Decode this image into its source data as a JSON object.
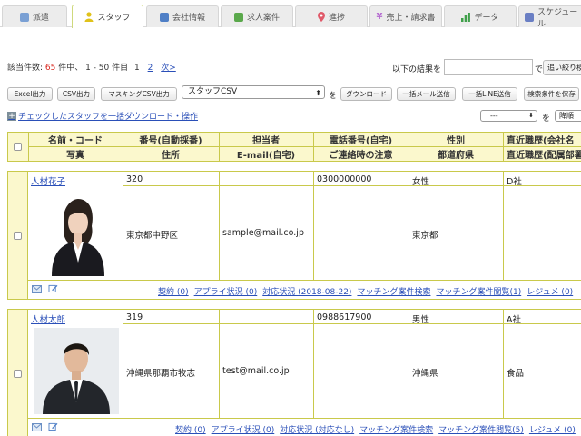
{
  "tabs": [
    {
      "label": "派遣",
      "icon": "building-icon",
      "color": "#7aa0d4",
      "active": false
    },
    {
      "label": "スタッフ",
      "icon": "person-icon",
      "color": "#e0c21a",
      "active": true
    },
    {
      "label": "会社情報",
      "icon": "office-icon",
      "color": "#4f7fc6",
      "active": false
    },
    {
      "label": "求人案件",
      "icon": "list-icon",
      "color": "#5aa84b",
      "active": false
    },
    {
      "label": "進捗",
      "icon": "pin-icon",
      "color": "#e05a6a",
      "active": false
    },
    {
      "label": "売上・請求書",
      "icon": "yen-icon",
      "color": "#b56ad0",
      "active": false
    },
    {
      "label": "データ",
      "icon": "chart-icon",
      "color": "#3fa04a",
      "active": false
    },
    {
      "label": "スケジュール",
      "icon": "calendar-icon",
      "color": "#6a7fc4",
      "active": false
    }
  ],
  "results": {
    "prefix": "該当件数:",
    "count": "65",
    "middle": "件中、 1 - 50 件目",
    "current_page": "1",
    "page2": "2",
    "next": "次>"
  },
  "filter": {
    "label": "以下の結果を",
    "value": "",
    "de": "で",
    "button": "追い絞り検索"
  },
  "toolbar": {
    "excel": "Excel出力",
    "csv": "CSV出力",
    "masking_csv": "マスキングCSV出力",
    "csv_select": "スタッフCSV",
    "wo": "を",
    "download": "ダウンロード",
    "bulk_mail": "一括メール送信",
    "bulk_line": "一括LINE送信",
    "save_search": "検索条件を保存"
  },
  "bulk_download_link": "チェックしたスタッフを一括ダウンロード・操作",
  "sort": {
    "value": "---",
    "wo": "を",
    "order": "降順"
  },
  "headers": {
    "row1": [
      "名前・コード",
      "番号(自動採番)",
      "担当者",
      "電話番号(自宅)",
      "性別",
      "直近職歴(会社名"
    ],
    "row2": [
      "写真",
      "住所",
      "E-mail(自宅)",
      "ご連絡時の注意",
      "都道府県",
      "直近職歴(配属部署"
    ]
  },
  "staff": [
    {
      "name": "人材花子",
      "number": "320",
      "manager": "",
      "phone": "0300000000",
      "gender": "女性",
      "company": "D社",
      "address": "東京都中野区",
      "email": "sample@mail.co.jp",
      "notes": "",
      "prefecture": "東京都",
      "department": "",
      "links": [
        "契約 (0)",
        "アプライ状況 (0)",
        "対応状況 (2018-08-22)",
        "マッチング案件検索",
        "マッチング案件閲覧(1)",
        "レジュメ (0)"
      ]
    },
    {
      "name": "人材太郎",
      "number": "319",
      "manager": "",
      "phone": "0988617900",
      "gender": "男性",
      "company": "A社",
      "address": "沖縄県那覇市牧志",
      "email": "test@mail.co.jp",
      "notes": "",
      "prefecture": "沖縄県",
      "department": "食品",
      "links": [
        "契約 (0)",
        "アプライ状況 (0)",
        "対応状況 (対応なし)",
        "マッチング案件検索",
        "マッチング案件閲覧(5)",
        "レジュメ (0)"
      ]
    }
  ]
}
